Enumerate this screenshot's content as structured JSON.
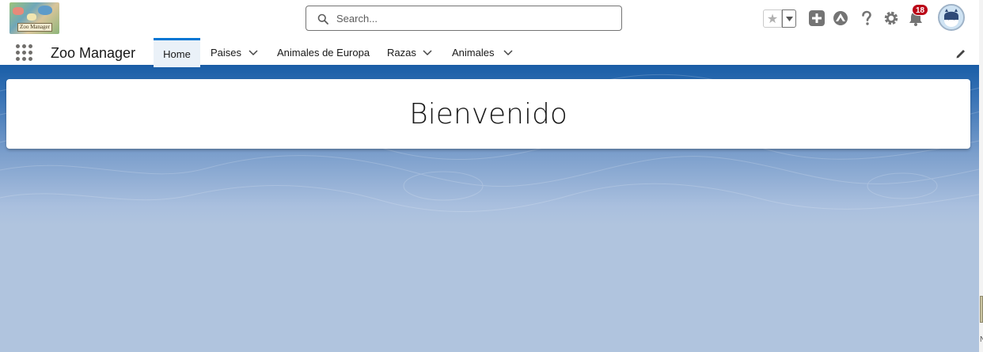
{
  "header": {
    "logo_text": "Zoo Manager",
    "search_placeholder": "Search...",
    "notifications_count": "18",
    "icons": [
      "search-icon",
      "star-icon",
      "chevron-down-icon",
      "add-icon",
      "trailhead-icon",
      "help-icon",
      "gear-icon",
      "bell-icon",
      "avatar-icon"
    ]
  },
  "nav": {
    "app_name": "Zoo Manager",
    "tabs": [
      {
        "label": "Home",
        "active": true,
        "has_menu": false
      },
      {
        "label": "Paises",
        "active": false,
        "has_menu": true
      },
      {
        "label": "Animales de Europa",
        "active": false,
        "has_menu": false
      },
      {
        "label": "Razas",
        "active": false,
        "has_menu": true
      },
      {
        "label": "Animales",
        "active": false,
        "has_menu": true
      }
    ]
  },
  "main": {
    "welcome_text": "Bienvenido"
  },
  "edge": {
    "text": "N"
  },
  "colors": {
    "brand_blue": "#0176d3",
    "nav_underline": "#1b5da6",
    "badge_red": "#ba0517",
    "page_background": "#b0c4de"
  }
}
